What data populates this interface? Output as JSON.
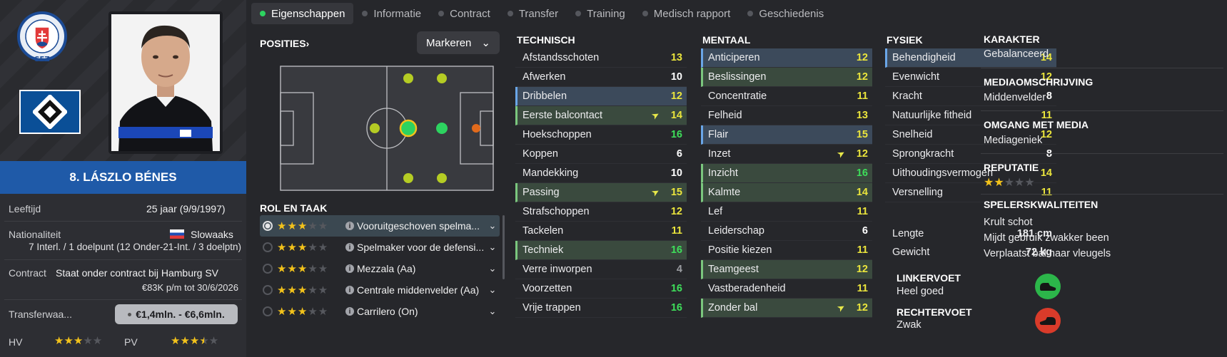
{
  "tabs": [
    {
      "label": "Eigenschappen",
      "active": true
    },
    {
      "label": "Informatie"
    },
    {
      "label": "Contract"
    },
    {
      "label": "Transfer"
    },
    {
      "label": "Training"
    },
    {
      "label": "Medisch rapport"
    },
    {
      "label": "Geschiedenis"
    }
  ],
  "player": {
    "name": "8. LÁSZLO BÉNES",
    "age_label": "Leeftijd",
    "age_value": "25 jaar (9/9/1997)",
    "nationality_label": "Nationaliteit",
    "nationality_value": "Slowaaks",
    "caps": "7 Interl. / 1 doelpunt (12 Onder-21-Int. / 3 doelptn)",
    "contract_label": "Contract",
    "contract_value": "Staat onder contract bij Hamburg SV",
    "contract_detail": "€83K p/m tot 30/6/2026",
    "transfer_label": "Transferwaa...",
    "transfer_value": "€1,4mln. - €6,6mln.",
    "hv_label": "HV",
    "hv_stars": 3,
    "pv_label": "PV",
    "pv_stars": 3.5,
    "badge_text": "SFZ"
  },
  "positions": {
    "title": "POSITIES",
    "markeren": "Markeren"
  },
  "roles": {
    "title": "ROL EN TAAK",
    "items": [
      {
        "name": "Vooruitgeschoven spelma...",
        "stars": 3,
        "selected": true
      },
      {
        "name": "Spelmaker voor de defensi...",
        "stars": 3
      },
      {
        "name": "Mezzala (Aa)",
        "stars": 3
      },
      {
        "name": "Centrale middenvelder (Aa)",
        "stars": 3
      },
      {
        "name": "Carrilero (On)",
        "stars": 3
      }
    ]
  },
  "technisch": {
    "title": "TECHNISCH",
    "items": [
      {
        "name": "Afstandsschoten",
        "value": 13,
        "color": "yellow"
      },
      {
        "name": "Afwerken",
        "value": 10,
        "color": "white"
      },
      {
        "name": "Dribbelen",
        "value": 12,
        "color": "yellow",
        "hl": "blue"
      },
      {
        "name": "Eerste balcontact",
        "value": 14,
        "color": "yellow",
        "hl": "green",
        "arrow": true
      },
      {
        "name": "Hoekschoppen",
        "value": 16,
        "color": "green"
      },
      {
        "name": "Koppen",
        "value": 6,
        "color": "white"
      },
      {
        "name": "Mandekking",
        "value": 10,
        "color": "white"
      },
      {
        "name": "Passing",
        "value": 15,
        "color": "yellow",
        "hl": "green",
        "arrow": true
      },
      {
        "name": "Strafschoppen",
        "value": 12,
        "color": "yellow"
      },
      {
        "name": "Tackelen",
        "value": 11,
        "color": "yellow"
      },
      {
        "name": "Techniek",
        "value": 16,
        "color": "green",
        "hl": "green"
      },
      {
        "name": "Verre inworpen",
        "value": 4,
        "color": "grey"
      },
      {
        "name": "Voorzetten",
        "value": 16,
        "color": "green"
      },
      {
        "name": "Vrije trappen",
        "value": 16,
        "color": "green"
      }
    ]
  },
  "mentaal": {
    "title": "MENTAAL",
    "items": [
      {
        "name": "Anticiperen",
        "value": 12,
        "color": "yellow",
        "hl": "blue"
      },
      {
        "name": "Beslissingen",
        "value": 12,
        "color": "yellow",
        "hl": "green"
      },
      {
        "name": "Concentratie",
        "value": 11,
        "color": "yellow"
      },
      {
        "name": "Felheid",
        "value": 13,
        "color": "yellow"
      },
      {
        "name": "Flair",
        "value": 15,
        "color": "yellow",
        "hl": "blue"
      },
      {
        "name": "Inzet",
        "value": 12,
        "color": "yellow",
        "arrow": true
      },
      {
        "name": "Inzicht",
        "value": 16,
        "color": "green",
        "hl": "green"
      },
      {
        "name": "Kalmte",
        "value": 14,
        "color": "yellow",
        "hl": "green"
      },
      {
        "name": "Lef",
        "value": 11,
        "color": "yellow"
      },
      {
        "name": "Leiderschap",
        "value": 6,
        "color": "white"
      },
      {
        "name": "Positie kiezen",
        "value": 11,
        "color": "yellow"
      },
      {
        "name": "Teamgeest",
        "value": 12,
        "color": "yellow",
        "hl": "green"
      },
      {
        "name": "Vastberadenheid",
        "value": 11,
        "color": "yellow"
      },
      {
        "name": "Zonder bal",
        "value": 12,
        "color": "yellow",
        "hl": "green",
        "arrow": true
      }
    ]
  },
  "fysiek": {
    "title": "FYSIEK",
    "items": [
      {
        "name": "Behendigheid",
        "value": 14,
        "color": "yellow",
        "hl": "blue"
      },
      {
        "name": "Evenwicht",
        "value": 12,
        "color": "yellow"
      },
      {
        "name": "Kracht",
        "value": 8,
        "color": "white"
      },
      {
        "name": "Natuurlijke fitheid",
        "value": 11,
        "color": "yellow"
      },
      {
        "name": "Snelheid",
        "value": 12,
        "color": "yellow"
      },
      {
        "name": "Sprongkracht",
        "value": 8,
        "color": "white"
      },
      {
        "name": "Uithoudingsvermogen",
        "value": 14,
        "color": "yellow"
      },
      {
        "name": "Versnelling",
        "value": 11,
        "color": "yellow"
      }
    ],
    "lengte_label": "Lengte",
    "lengte_value": "181 cm",
    "gewicht_label": "Gewicht",
    "gewicht_value": "72 kg",
    "linkervoet_label": "LINKERVOET",
    "linkervoet_value": "Heel goed",
    "rechtervoet_label": "RECHTERVOET",
    "rechtervoet_value": "Zwak"
  },
  "karakter": {
    "title": "KARAKTER",
    "value": "Gebalanceerd",
    "media_title": "MEDIAOMSCHRIJVING",
    "media_value": "Middenvelder",
    "omgang_title": "OMGANG MET MEDIA",
    "omgang_value": "Mediageniek",
    "reputatie_title": "REPUTATIE",
    "reputatie_stars": 2,
    "kwaliteiten_title": "SPELERSKWALITEITEN",
    "kwaliteiten": [
      "Krult schot",
      "Mijdt gebruik zwakker been",
      "Verplaatst bal naar vleugels"
    ]
  },
  "colors": {
    "yellow": "#ebe53c",
    "green": "#3ede5a",
    "accent_blue": "#1f5aa8"
  }
}
